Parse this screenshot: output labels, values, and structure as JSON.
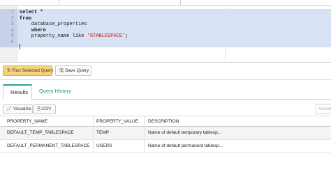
{
  "editor": {
    "lines": [
      {
        "num": "1",
        "parts": [
          {
            "t": "select *",
            "cls": "kw"
          }
        ]
      },
      {
        "num": "2",
        "parts": [
          {
            "t": "from",
            "cls": "kw"
          }
        ]
      },
      {
        "num": "3",
        "parts": [
          {
            "t": "    database_properties",
            "cls": ""
          }
        ]
      },
      {
        "num": "4",
        "parts": [
          {
            "t": "    where",
            "cls": "kw"
          }
        ]
      },
      {
        "num": "5",
        "parts": [
          {
            "t": "    property_name like ",
            "cls": ""
          },
          {
            "t": "'%TABLESPACE'",
            "cls": "str"
          },
          {
            "t": ";",
            "cls": ""
          }
        ]
      },
      {
        "num": "6",
        "parts": []
      }
    ]
  },
  "toolbar": {
    "run_label": "Run Selected Query",
    "save_label": "Save Query"
  },
  "tabs": {
    "results": "Results",
    "history": "Query History"
  },
  "results_toolbar": {
    "visualize_label": "Visualize",
    "csv_label": ".CSV",
    "search_placeholder": "Search"
  },
  "table": {
    "columns": [
      "PROPERTY_NAME",
      "PROPERTY_VALUE",
      "DESCRIPTION"
    ],
    "rows": [
      [
        "DEFAULT_TEMP_TABLESPACE",
        "TEMP",
        "Name of default temporary tablesp..."
      ],
      [
        "DEFAULT_PERMANENT_TABLESPACE",
        "USERS",
        "Name of default permanent tablesp..."
      ]
    ]
  },
  "colors": {
    "accent": "#2aa198",
    "run_button": "#f6d37a",
    "selection": "#d7e2f5"
  }
}
